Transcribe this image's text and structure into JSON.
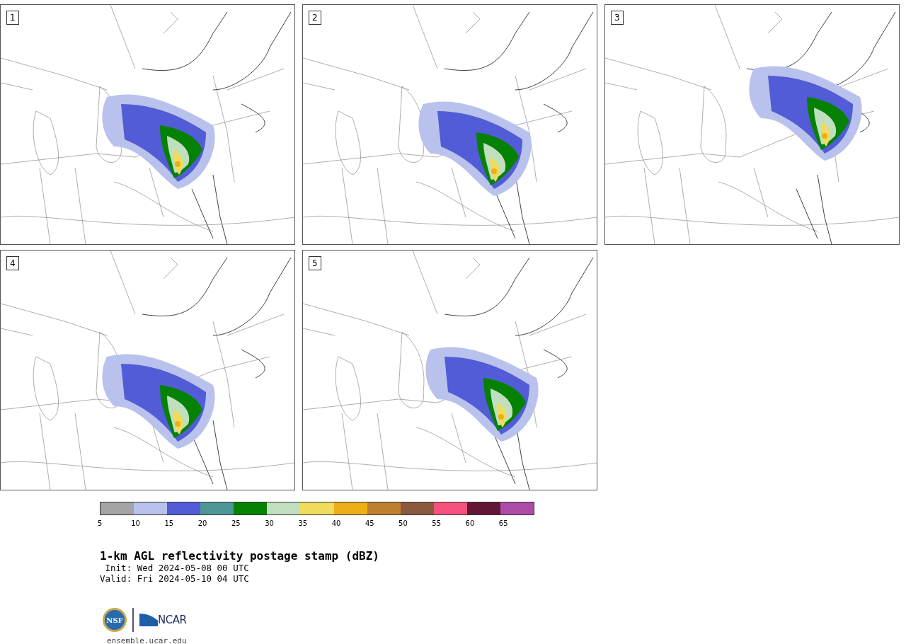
{
  "panels": [
    {
      "label": "1"
    },
    {
      "label": "2"
    },
    {
      "label": "3"
    },
    {
      "label": "4"
    },
    {
      "label": "5"
    }
  ],
  "colorbar": {
    "segments": [
      {
        "color": "#a4a4a4"
      },
      {
        "color": "#b8c2ec"
      },
      {
        "color": "#525cd6"
      },
      {
        "color": "#4f9699"
      },
      {
        "color": "#058103"
      },
      {
        "color": "#bfdfbf"
      },
      {
        "color": "#efdc5c"
      },
      {
        "color": "#eeae18"
      },
      {
        "color": "#bb812f"
      },
      {
        "color": "#8a5a3f"
      },
      {
        "color": "#f4517c"
      },
      {
        "color": "#621736"
      },
      {
        "color": "#ac4ca7"
      }
    ],
    "ticks": [
      "5",
      "10",
      "15",
      "20",
      "25",
      "30",
      "35",
      "40",
      "45",
      "50",
      "55",
      "60",
      "65"
    ]
  },
  "title": "1-km AGL reflectivity postage stamp (dBZ)",
  "init": " Init: Wed 2024-05-08 00 UTC",
  "valid": "Valid: Fri 2024-05-10 04 UTC",
  "seal_text": "NSF",
  "logo_text": "NCAR",
  "url": "ensemble.ucar.edu"
}
